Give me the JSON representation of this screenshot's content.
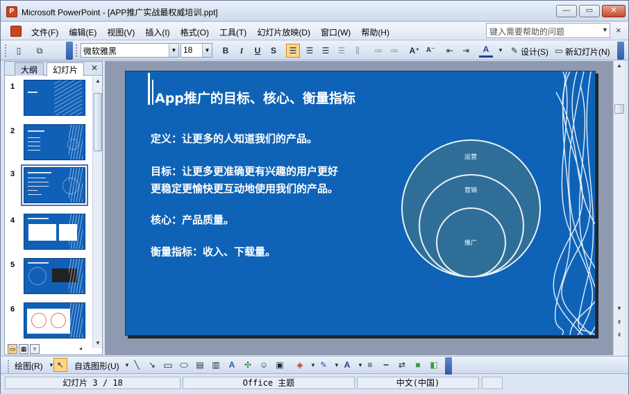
{
  "window": {
    "title": "Microsoft PowerPoint - [APP推广实战最权威培训.ppt]"
  },
  "menu": {
    "items": [
      "文件(F)",
      "编辑(E)",
      "视图(V)",
      "插入(I)",
      "格式(O)",
      "工具(T)",
      "幻灯片放映(D)",
      "窗口(W)",
      "帮助(H)"
    ],
    "help_placeholder": "键入需要帮助的问题"
  },
  "toolbar": {
    "font_name": "微软雅黑",
    "font_size": "18",
    "design_label": "设计(S)",
    "new_slide_label": "新幻灯片(N)"
  },
  "pane": {
    "tabs": [
      "大纲",
      "幻灯片"
    ],
    "thumbnails": [
      {
        "num": "1"
      },
      {
        "num": "2"
      },
      {
        "num": "3"
      },
      {
        "num": "4"
      },
      {
        "num": "5"
      },
      {
        "num": "6"
      }
    ],
    "selected": 3
  },
  "slide": {
    "title": "App推广的目标、核心、衡量指标",
    "lines": [
      "定义：让更多的人知道我们的产品。",
      "目标：让更多更准确更有兴趣的用户更好",
      "更稳定更愉快更互动地使用我们的产品。",
      "核心：产品质量。",
      "衡量指标：收入、下载量。"
    ],
    "circles": [
      "运营",
      "营销",
      "推广"
    ]
  },
  "drawbar": {
    "draw_label": "绘图(R)",
    "autoshape_label": "自选图形(U)"
  },
  "status": {
    "slide_position": "幻灯片 3 / 18",
    "theme": "Office 主题",
    "language": "中文(中国)"
  },
  "colors": {
    "slide_background": "#0f63b7",
    "circle_fill": "#2f6f97",
    "active_button": "#fbd68a"
  }
}
